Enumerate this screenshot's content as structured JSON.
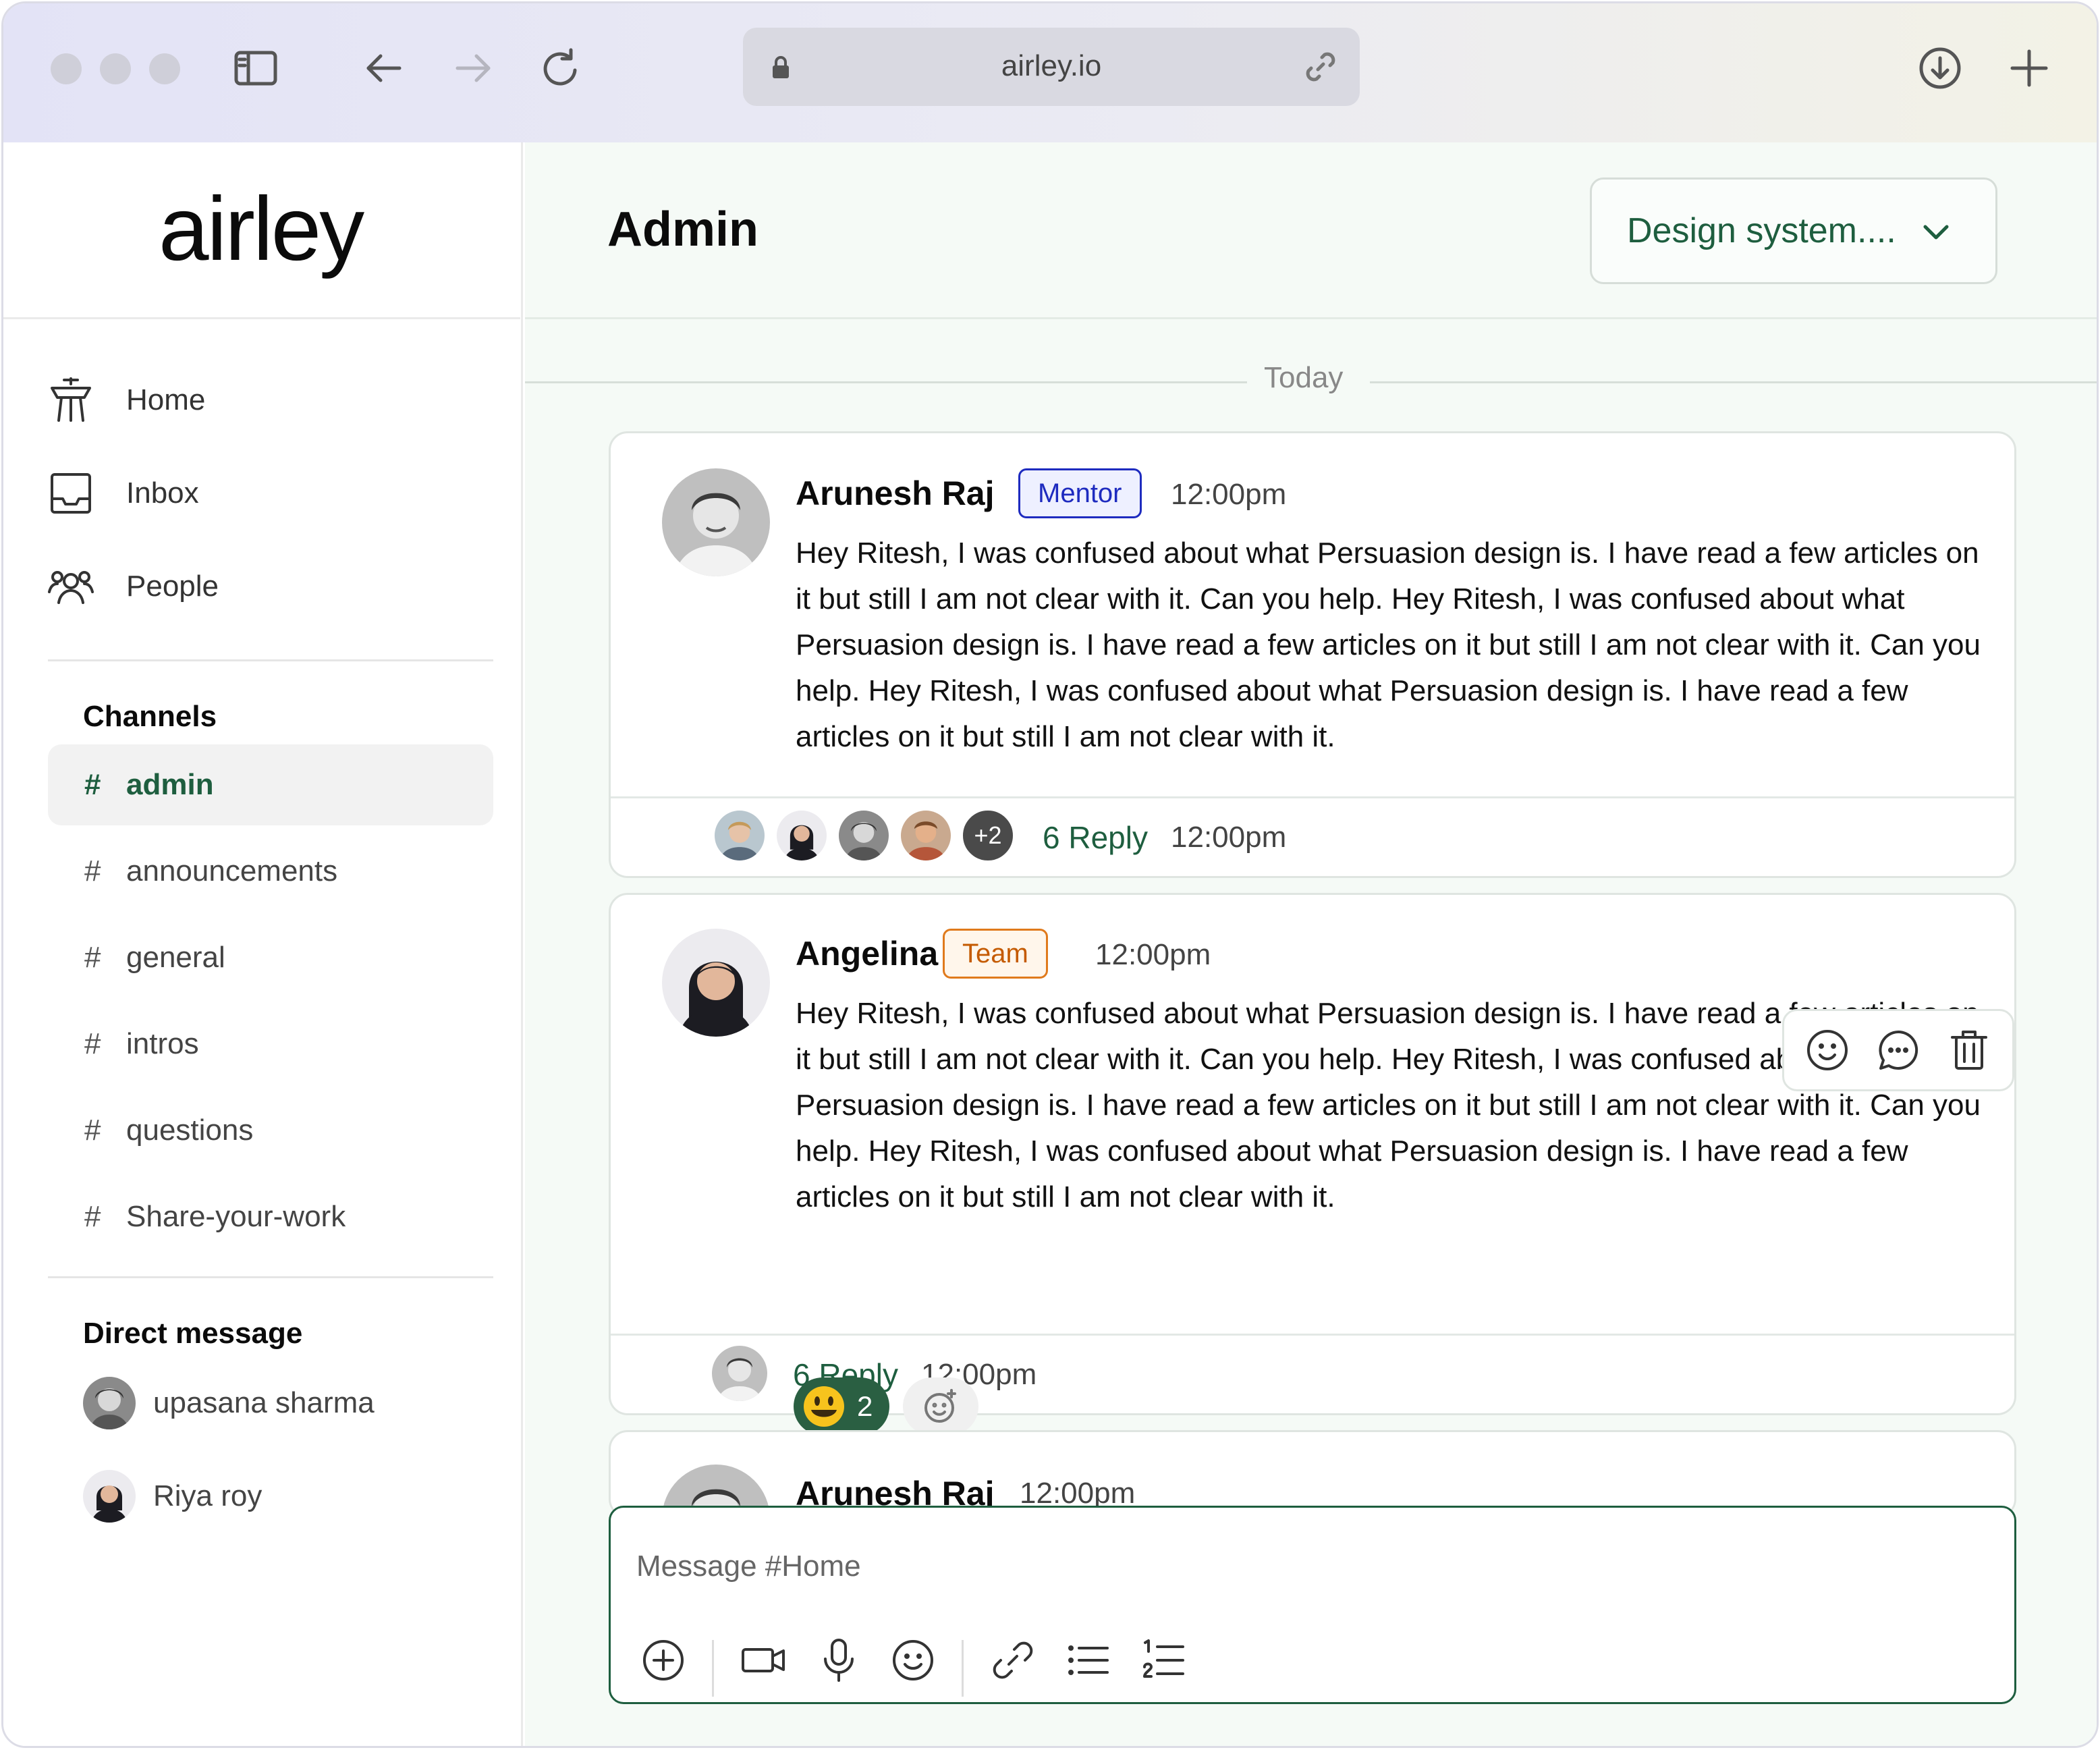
{
  "browser": {
    "url": "airley.io"
  },
  "sidebar": {
    "logo": "airley",
    "nav": [
      {
        "label": "Home",
        "icon": "home-tower-icon"
      },
      {
        "label": "Inbox",
        "icon": "inbox-icon"
      },
      {
        "label": "People",
        "icon": "people-icon"
      }
    ],
    "channels_title": "Channels",
    "channels": [
      {
        "label": "admin",
        "active": true
      },
      {
        "label": "announcements",
        "active": false
      },
      {
        "label": "general",
        "active": false
      },
      {
        "label": "intros",
        "active": false
      },
      {
        "label": "questions",
        "active": false
      },
      {
        "label": "Share-your-work",
        "active": false
      }
    ],
    "dm_title": "Direct message",
    "dms": [
      {
        "label": "upasana sharma"
      },
      {
        "label": "Riya roy"
      }
    ],
    "hash": "#"
  },
  "main": {
    "title": "Admin",
    "workspace_dropdown": "Design system....",
    "date_divider": "Today",
    "messages": [
      {
        "author": "Arunesh Raj",
        "role": "Mentor",
        "time": "12:00pm",
        "text": "Hey Ritesh, I was confused about what Persuasion design is. I have read a few articles on it but still I am not clear with it. Can you help. Hey Ritesh, I was confused about what Persuasion design is. I have read a few articles on it but still I am not clear with it. Can you help. Hey Ritesh, I was confused about what Persuasion design is. I have read a few articles on it but still I am not clear with it.",
        "reply_more": "+2",
        "reply_label": "6 Reply",
        "reply_time": "12:00pm"
      },
      {
        "author": "Angelina",
        "role": "Team",
        "time": "12:00pm",
        "text": "Hey Ritesh, I was confused about what Persuasion design is. I have read a few articles on it but still I am not clear with it. Can you help. Hey Ritesh, I was confused about what Persuasion design is. I have read a few articles on it but still I am not clear with it. Can you help. Hey Ritesh, I was confused about what Persuasion design is. I have read a few articles on it but still I am not clear with it.",
        "reaction_count": "2",
        "reply_label": "6 Reply",
        "reply_time": "12:00pm"
      },
      {
        "author": "Arunesh Raj",
        "time": "12:00pm"
      }
    ],
    "composer": {
      "placeholder": "Message #Home"
    }
  },
  "colors": {
    "accent": "#1e5e3f",
    "mentor": "#1e2bbf",
    "team": "#e07a1c",
    "main_bg": "#f5faf6"
  }
}
